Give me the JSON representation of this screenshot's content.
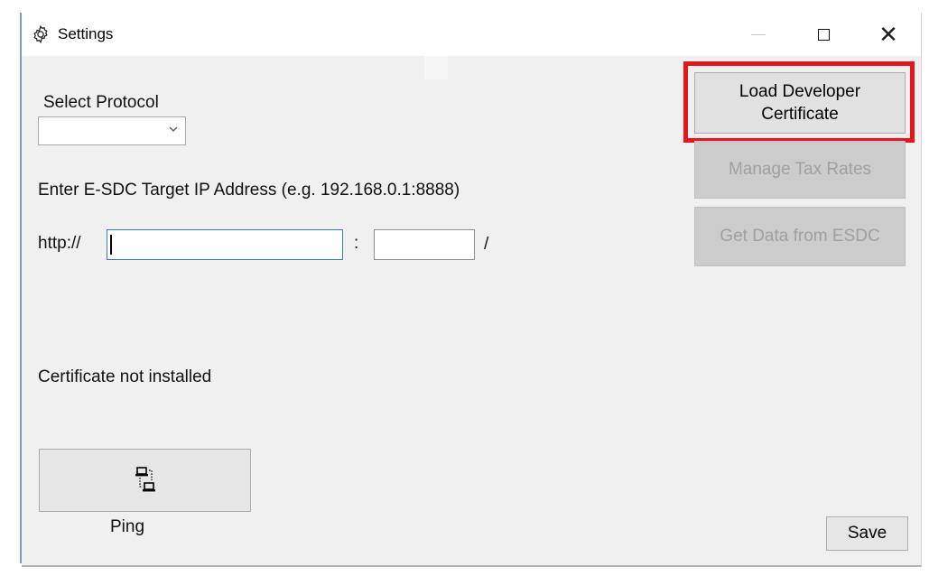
{
  "window": {
    "title": "Settings",
    "icon": "gear-icon"
  },
  "protocol": {
    "label": "Select Protocol",
    "selected": ""
  },
  "target": {
    "label": "Enter E-SDC Target IP Address (e.g. 192.168.0.1:8888)",
    "scheme": "http://",
    "colon": ":",
    "slash": "/",
    "host_value": "",
    "port_value": ""
  },
  "certificate_status": "Certificate not installed",
  "buttons": {
    "load_certificate": "Load Developer Certificate",
    "manage_tax_rates": "Manage Tax Rates",
    "get_data": "Get Data from ESDC",
    "ping": "Ping",
    "save": "Save"
  },
  "colors": {
    "highlight": "#e8151b",
    "focus_border": "#3c7ad1",
    "window_bg": "#f0f0f0"
  }
}
